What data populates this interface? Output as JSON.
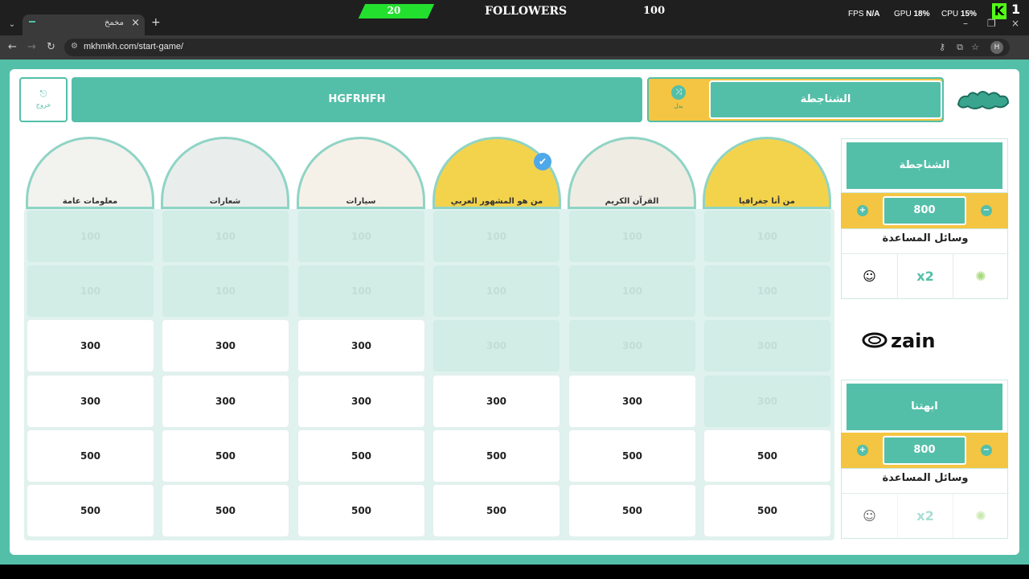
{
  "browser": {
    "tab_title": "مخمخ",
    "url": "mkhmkh.com/start-game/",
    "profile_initial": "H"
  },
  "overlay": {
    "followers_count": "20",
    "followers_label": "FOLLOWERS",
    "followers_goal": "100",
    "fps_label": "FPS",
    "fps_value": "N/A",
    "gpu_label": "GPU",
    "gpu_value": "18%",
    "cpu_label": "CPU",
    "cpu_value": "15%",
    "kick_letter": "K",
    "kick_num": "1",
    "progress": 0.2
  },
  "header": {
    "exit_label": "خروج",
    "current_team_banner": "HGFRHFH",
    "turn_sublabel": "بدل",
    "turn_team": "الشناجطة"
  },
  "categories": [
    {
      "name": "معلومات عامة",
      "checked": false
    },
    {
      "name": "شعارات",
      "checked": false
    },
    {
      "name": "سيارات",
      "checked": false
    },
    {
      "name": "من هو المشهور العربي",
      "checked": true
    },
    {
      "name": "القرآن الكريم",
      "checked": false
    },
    {
      "name": "من أنا جغرافيا",
      "checked": false
    }
  ],
  "grid": [
    [
      {
        "v": "100",
        "on": false
      },
      {
        "v": "100",
        "on": false
      },
      {
        "v": "100",
        "on": false
      },
      {
        "v": "100",
        "on": false
      },
      {
        "v": "100",
        "on": false
      },
      {
        "v": "100",
        "on": false
      }
    ],
    [
      {
        "v": "100",
        "on": false
      },
      {
        "v": "100",
        "on": false
      },
      {
        "v": "100",
        "on": false
      },
      {
        "v": "100",
        "on": false
      },
      {
        "v": "100",
        "on": false
      },
      {
        "v": "100",
        "on": false
      }
    ],
    [
      {
        "v": "300",
        "on": true
      },
      {
        "v": "300",
        "on": true
      },
      {
        "v": "300",
        "on": true
      },
      {
        "v": "300",
        "on": false
      },
      {
        "v": "300",
        "on": false
      },
      {
        "v": "300",
        "on": false
      }
    ],
    [
      {
        "v": "300",
        "on": true
      },
      {
        "v": "300",
        "on": true
      },
      {
        "v": "300",
        "on": true
      },
      {
        "v": "300",
        "on": true
      },
      {
        "v": "300",
        "on": true
      },
      {
        "v": "300",
        "on": false
      }
    ],
    [
      {
        "v": "500",
        "on": true
      },
      {
        "v": "500",
        "on": true
      },
      {
        "v": "500",
        "on": true
      },
      {
        "v": "500",
        "on": true
      },
      {
        "v": "500",
        "on": true
      },
      {
        "v": "500",
        "on": true
      }
    ],
    [
      {
        "v": "500",
        "on": true
      },
      {
        "v": "500",
        "on": true
      },
      {
        "v": "500",
        "on": true
      },
      {
        "v": "500",
        "on": true
      },
      {
        "v": "500",
        "on": true
      },
      {
        "v": "500",
        "on": true
      }
    ]
  ],
  "teams": [
    {
      "name": "الشناجطة",
      "score": "800",
      "aids_title": "وسائل المساعدة",
      "aid_double": "x2"
    },
    {
      "name": "ابهتنا",
      "score": "800",
      "aids_title": "وسائل المساعدة",
      "aid_double": "x2"
    }
  ],
  "sponsor": "zain",
  "colors": {
    "teal": "#54bfa9",
    "yellow": "#f4c542",
    "kick_green": "#53fc18"
  }
}
